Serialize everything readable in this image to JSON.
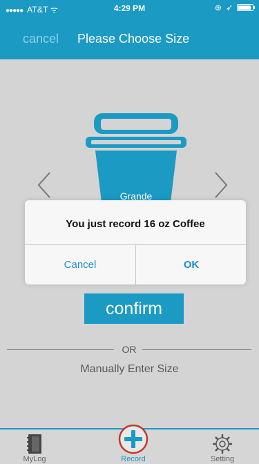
{
  "status_bar": {
    "carrier": "AT&T",
    "time": "4:29 PM"
  },
  "nav": {
    "cancel_label": "cancel",
    "title": "Please Choose Size"
  },
  "selector": {
    "size_label": "Grande",
    "confirm_label": "confirm",
    "or_label": "OR",
    "manual_label": "Manually Enter Size"
  },
  "alert": {
    "message": "You just record 16 oz Coffee",
    "cancel_label": "Cancel",
    "ok_label": "OK"
  },
  "tabbar": {
    "items": [
      {
        "label": "MyLog",
        "icon": "notebook-icon"
      },
      {
        "label": "Record",
        "icon": "plus-circle-icon"
      },
      {
        "label": "Setting",
        "icon": "gear-icon"
      }
    ],
    "active_index": 1
  },
  "colors": {
    "accent": "#1b9ac4",
    "background": "#d4d4d4",
    "record_ring": "#c0392b"
  }
}
